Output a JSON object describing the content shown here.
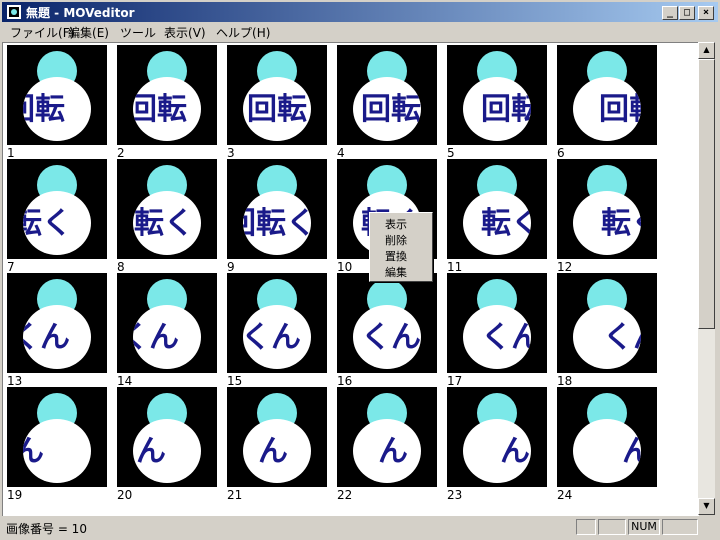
{
  "window": {
    "title": "無題 - MOVeditor",
    "buttons": {
      "minimize": "_",
      "maximize": "□",
      "close": "×"
    }
  },
  "menu": [
    {
      "label": "ファイル",
      "key": "(F)"
    },
    {
      "label": "編集",
      "key": "(E)"
    },
    {
      "label": "ツール",
      "key": ""
    },
    {
      "label": "表示",
      "key": "(V)"
    },
    {
      "label": "ヘルプ",
      "key": "(H)"
    }
  ],
  "frames": {
    "numbers": [
      "1",
      "2",
      "3",
      "4",
      "5",
      "6",
      "7",
      "8",
      "9",
      "10",
      "11",
      "12",
      "13",
      "14",
      "15",
      "16",
      "17",
      "18",
      "19",
      "20",
      "21",
      "22",
      "23",
      "24"
    ],
    "caption": [
      "回転",
      "回転",
      "回転",
      "回転",
      "回転",
      "回転",
      "回転く",
      "回転く",
      "回転く",
      "転く",
      "転く",
      "転く",
      "転くん",
      "くん",
      "くん",
      "くん",
      "くん",
      "くん",
      "ん",
      "ん",
      "ん",
      "ん",
      "ん",
      "ん"
    ],
    "caption_offset": [
      -22,
      -10,
      0,
      4,
      14,
      22,
      -30,
      -18,
      -6,
      4,
      14,
      24,
      -32,
      -18,
      -6,
      4,
      14,
      26,
      -28,
      -16,
      -4,
      6,
      18,
      30
    ]
  },
  "context_menu": [
    "表示",
    "削除",
    "置換",
    "編集"
  ],
  "status": {
    "text": "画像番号 = 10",
    "pane_num": "NUM"
  },
  "colors": {
    "titlebar_start": "#0a246a",
    "titlebar_end": "#a6caf0",
    "head": "#7be8e8",
    "body": "#ffffff",
    "text": "#1a1a8a"
  }
}
